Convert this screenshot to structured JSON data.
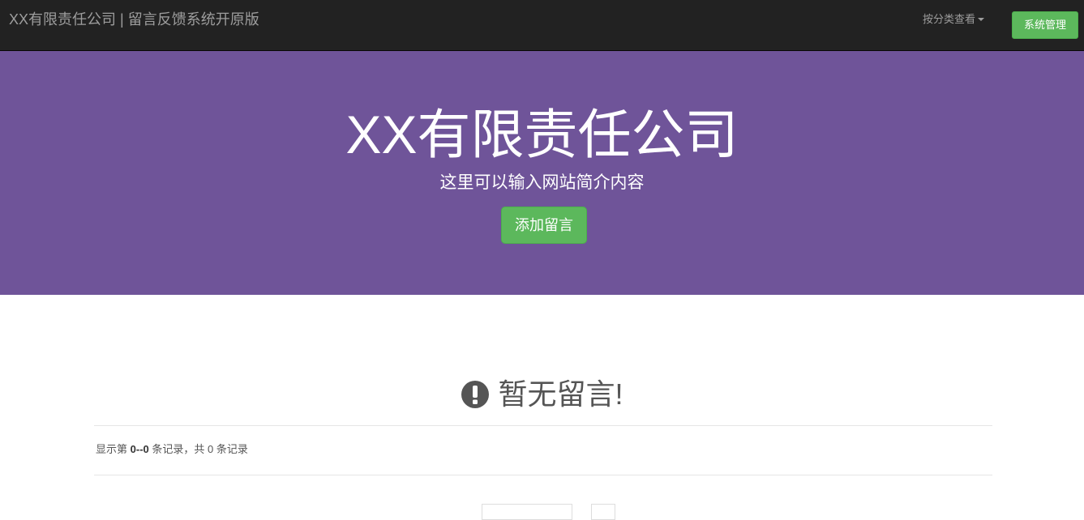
{
  "navbar": {
    "brand": "XX有限责任公司 | 留言反馈系统开原版",
    "category_dropdown": "按分类查看",
    "admin_button": "系统管理"
  },
  "hero": {
    "title": "XX有限责任公司",
    "subtitle": "这里可以输入网站简介内容",
    "add_button": "添加留言"
  },
  "empty_state": {
    "icon": "exclamation-circle-icon",
    "message": "暂无留言!"
  },
  "records": {
    "prefix": "显示第",
    "range": "0--0",
    "middle": "条记录，共",
    "total": "0",
    "suffix": "条记录"
  },
  "colors": {
    "navbar_bg": "#222222",
    "hero_bg": "#6f5499",
    "success": "#5cb85c"
  }
}
